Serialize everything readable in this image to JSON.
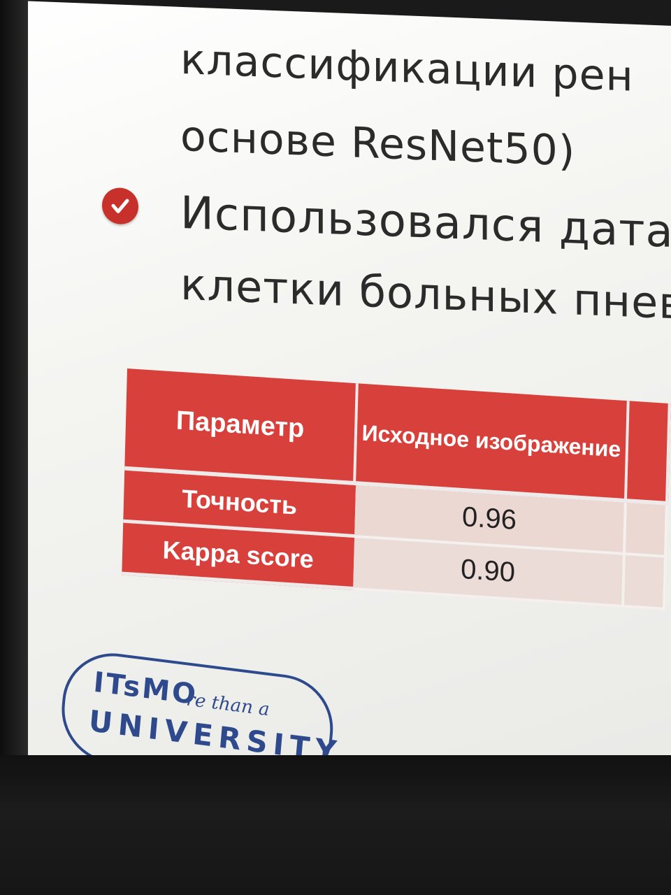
{
  "slide": {
    "lines": [
      "классификации рен",
      "основе ResNet50)",
      "Использовался дата",
      "клетки больных пнев"
    ]
  },
  "table": {
    "headers": [
      "Параметр",
      "Исходное изображение"
    ],
    "rows": [
      {
        "label": "Точность",
        "value": "0.96"
      },
      {
        "label": "Kappa score",
        "value": "0.90"
      }
    ]
  },
  "logo": {
    "text_top": "ITsMO",
    "text_script": "re than a",
    "text_bottom": "UNIVERSITY"
  },
  "colors": {
    "accent": "#d8403b",
    "cell_bg": "#ecd8d2",
    "logo_blue": "#2e4a8c"
  },
  "icons": [
    "checkmark-icon"
  ]
}
